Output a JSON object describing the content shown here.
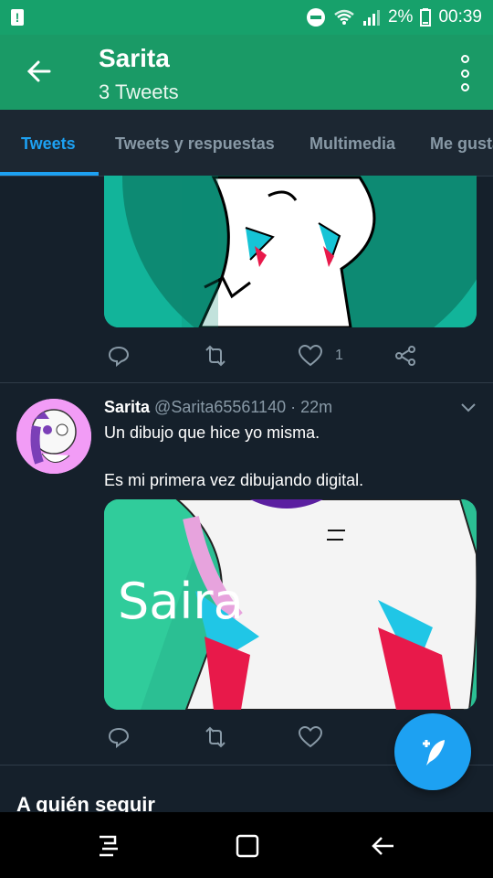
{
  "status_bar": {
    "battery_percent": "2%",
    "time": "00:39",
    "icons": [
      "alert-icon",
      "dnd-icon",
      "wifi-icon",
      "signal-icon",
      "battery-icon"
    ]
  },
  "header": {
    "title": "Sarita",
    "subtitle": "3 Tweets",
    "icons": [
      "back-arrow-icon",
      "more-options-icon"
    ]
  },
  "tabs": [
    {
      "label": "Tweets",
      "active": true
    },
    {
      "label": "Tweets y respuestas",
      "active": false
    },
    {
      "label": "Multimedia",
      "active": false
    },
    {
      "label": "Me gusta",
      "active": false
    }
  ],
  "tweet_1": {
    "likes": "1",
    "actions": [
      "reply-icon",
      "retweet-icon",
      "like-icon",
      "share-icon"
    ]
  },
  "tweet_2": {
    "name": "Sarita",
    "handle": "@Sarita65561140",
    "time": "· 22m",
    "text": "Un dibujo que hice yo misma.\n\nEs mi primera vez dibujando digital.",
    "media_text": "Saira",
    "actions": [
      "reply-icon",
      "retweet-icon",
      "like-icon",
      "share-icon"
    ]
  },
  "section_title": "A quién seguir",
  "colors": {
    "header_bg": "#1a9a66",
    "statusbar_bg": "#17a16b",
    "accent": "#1da1f2",
    "background": "#15202b",
    "muted_text": "#8899a6"
  }
}
